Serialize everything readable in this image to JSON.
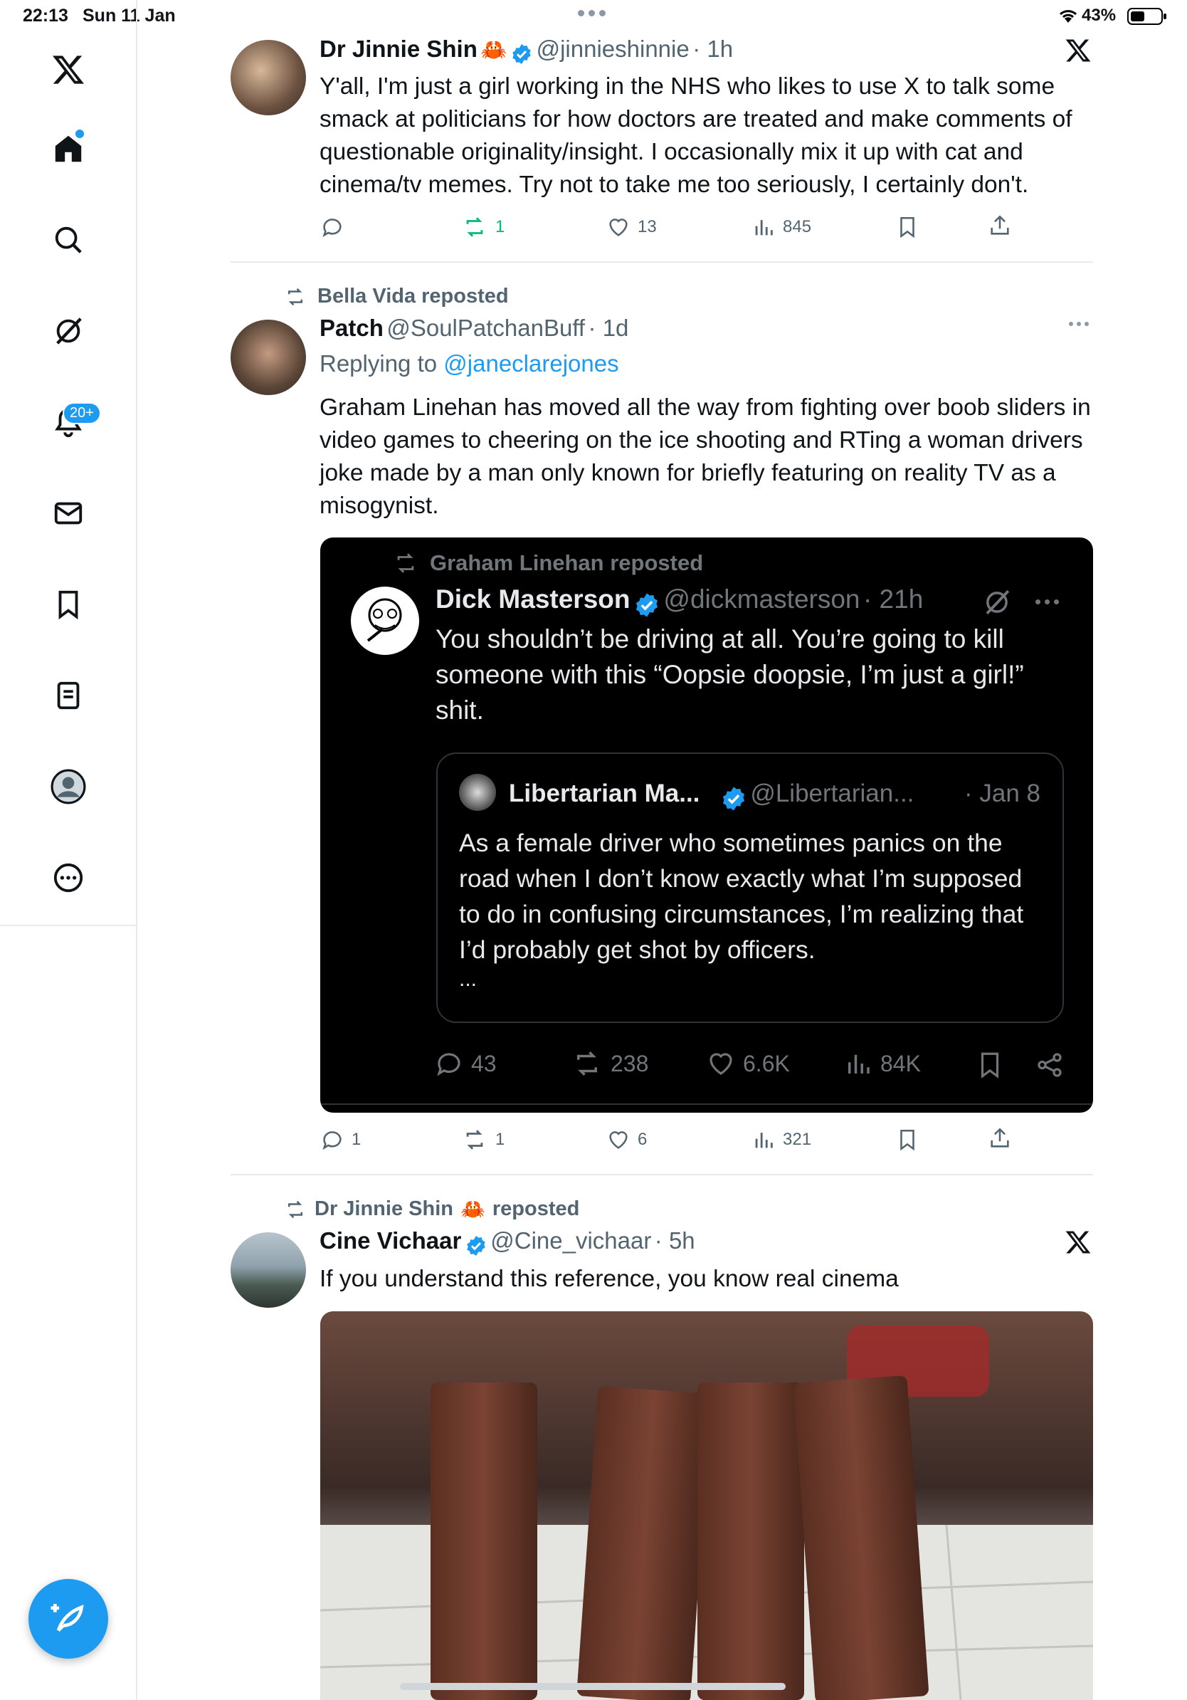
{
  "status_bar": {
    "time": "22:13",
    "date": "Sun 11 Jan",
    "battery": "43%"
  },
  "sidebar": {
    "notifications_badge": "20+",
    "items": [
      "X logo",
      "Home",
      "Search",
      "Grok",
      "Notifications",
      "Messages",
      "Bookmarks",
      "Lists",
      "Profile",
      "More"
    ]
  },
  "tweets": [
    {
      "name": "Dr Jinnie Shin",
      "handle": "@jinnieshinnie",
      "time": "· 1h",
      "text": "Y'all, I'm just a girl working in the NHS who likes to use X to talk some smack at politicians for how doctors are treated and make comments of questionable originality/insight. I occasionally mix it up with cat and cinema/tv memes. Try not to take me too seriously, I certainly don't.",
      "replies": "",
      "reposts": "1",
      "likes": "13",
      "views": "845"
    },
    {
      "repost_label": "Bella Vida reposted",
      "name": "Patch",
      "handle": "@SoulPatchanBuff",
      "time": "· 1d",
      "replying_prefix": "Replying to",
      "replying_to": "@janeclarejones",
      "text": "Graham Linehan has moved all the way from fighting over boob sliders in video games to cheering on the ice shooting and RTing a woman drivers joke made by a man only known for briefly featuring on reality TV as a misogynist.",
      "replies": "1",
      "reposts": "1",
      "likes": "6",
      "views": "321",
      "embed": {
        "repost_label": "Graham Linehan reposted",
        "name": "Dick Masterson",
        "handle": "@dickmasterson",
        "time": "· 21h",
        "text": "You shouldn’t be driving at all. You’re going to kill someone with this “Oopsie doopsie, I’m just a girl!” shit.",
        "quote": {
          "name": "Libertarian Ma...",
          "handle": "@Libertarian...",
          "time": "· Jan 8",
          "text": "As a female driver who sometimes panics on the road when I don’t know exactly what I’m supposed to do in confusing circumstances, I’m realizing that I’d probably get shot by officers.",
          "ellipsis": "..."
        },
        "replies": "43",
        "reposts": "238",
        "likes": "6.6K",
        "views": "84K"
      }
    },
    {
      "repost_label_name": "Dr Jinnie Shin",
      "repost_label_suffix": "reposted",
      "name": "Cine Vichaar",
      "handle": "@Cine_vichaar",
      "time": "· 5h",
      "text": "If you understand this reference, you know real cinema"
    }
  ],
  "colors": {
    "accent": "#1d9bf0",
    "repost_green": "#00ba7c",
    "text": "#0f1419",
    "muted": "#536471"
  }
}
